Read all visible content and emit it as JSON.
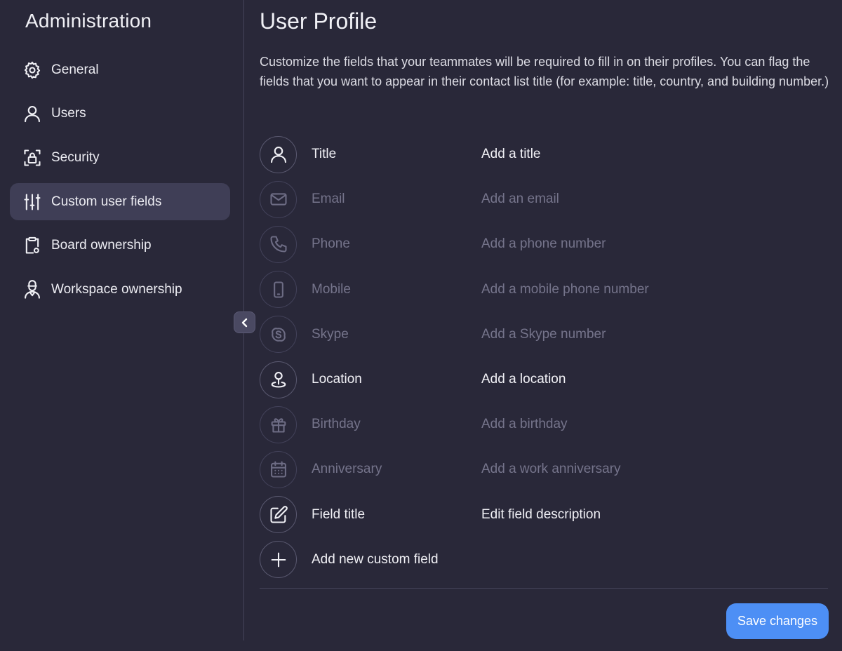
{
  "sidebar": {
    "title": "Administration",
    "items": [
      {
        "label": "General",
        "icon": "gear-icon",
        "active": false
      },
      {
        "label": "Users",
        "icon": "user-icon",
        "active": false
      },
      {
        "label": "Security",
        "icon": "lock-icon",
        "active": false
      },
      {
        "label": "Custom user fields",
        "icon": "sliders-icon",
        "active": true
      },
      {
        "label": "Board ownership",
        "icon": "clipboard-icon",
        "active": false
      },
      {
        "label": "Workspace ownership",
        "icon": "worker-icon",
        "active": false
      }
    ]
  },
  "main": {
    "title": "User Profile",
    "description": "Customize the fields that your teammates will be required to fill in on their profiles. You can flag the fields that you want to appear in their contact list title (for example: title, country, and building number.)",
    "fields": [
      {
        "name": "Title",
        "description": "Add a title",
        "icon": "user-icon",
        "enabled": true
      },
      {
        "name": "Email",
        "description": "Add an email",
        "icon": "envelope-icon",
        "enabled": false
      },
      {
        "name": "Phone",
        "description": "Add a phone number",
        "icon": "phone-icon",
        "enabled": false
      },
      {
        "name": "Mobile",
        "description": "Add a mobile phone number",
        "icon": "mobile-icon",
        "enabled": false
      },
      {
        "name": "Skype",
        "description": "Add a Skype number",
        "icon": "skype-icon",
        "enabled": false
      },
      {
        "name": "Location",
        "description": "Add a location",
        "icon": "location-pin-icon",
        "enabled": true
      },
      {
        "name": "Birthday",
        "description": "Add a birthday",
        "icon": "gift-icon",
        "enabled": false
      },
      {
        "name": "Anniversary",
        "description": "Add a work anniversary",
        "icon": "calendar-icon",
        "enabled": false
      },
      {
        "name": "Field title",
        "description": "Edit field description",
        "icon": "edit-icon",
        "enabled": true
      }
    ],
    "add_field_label": "Add new custom field",
    "save_label": "Save changes"
  },
  "colors": {
    "background": "#292839",
    "active_nav": "#3f3e56",
    "accent": "#4d8ff5"
  }
}
